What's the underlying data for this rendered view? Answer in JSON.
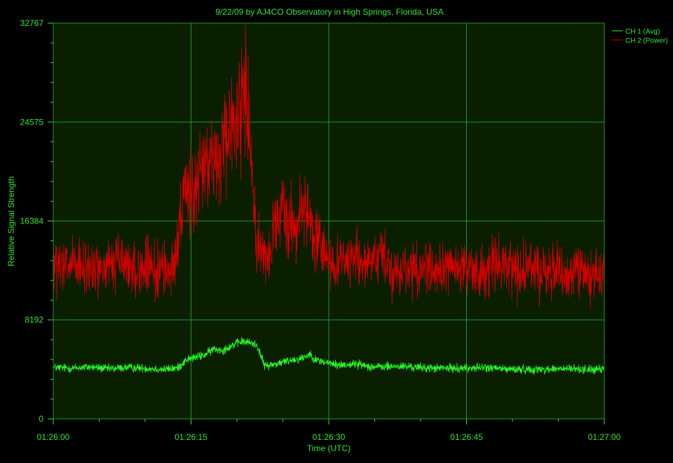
{
  "colors": {
    "background": "#000000",
    "plot_background": "#0a1f00",
    "grid": "#1f9a1f",
    "text": "#33e633",
    "ch1": "#2aff2a",
    "ch2": "#d40000"
  },
  "chart_data": {
    "type": "line",
    "title": "9/22/09  by  AJ4CO Observatory  in  High Springs, Florida, USA",
    "xlabel": "Time (UTC)",
    "ylabel": "Relative Signal Strength",
    "x_tick_labels": [
      "01:26:00",
      "01:26:15",
      "01:26:30",
      "01:26:45",
      "01:27:00"
    ],
    "x_ticks_seconds_label": "seconds after 01:26:00",
    "xlim": [
      0,
      60
    ],
    "ylim": [
      0,
      32767
    ],
    "y_ticks": [
      0,
      8192,
      16384,
      24575,
      32767
    ],
    "y_tick_labels": [
      "0",
      "8192",
      "16384",
      "24575",
      "32767"
    ],
    "grid": true,
    "legend_position": "top-right",
    "series": [
      {
        "name": "CH 1 (Avg)",
        "x": [
          0,
          2,
          4,
          6,
          8,
          10,
          12,
          13.5,
          14.5,
          15.5,
          16.5,
          17.5,
          18.5,
          19.5,
          20.5,
          21.5,
          22.2,
          23,
          24,
          25,
          26,
          27,
          28,
          28.5,
          29.5,
          31,
          33,
          35,
          38,
          41,
          44,
          47,
          50,
          53,
          56,
          58,
          60
        ],
        "y": [
          4250,
          4200,
          4300,
          4150,
          4250,
          4200,
          4100,
          4200,
          4900,
          5100,
          5300,
          5800,
          5700,
          6100,
          6400,
          6300,
          6100,
          4400,
          4500,
          4700,
          4900,
          5000,
          5400,
          4900,
          4700,
          4450,
          4550,
          4300,
          4350,
          4200,
          4200,
          4250,
          4100,
          4100,
          4150,
          4100,
          4050
        ]
      },
      {
        "name": "CH 2 (Power)",
        "x": [
          0,
          1,
          2,
          3,
          4,
          5,
          6,
          7,
          8,
          9,
          10,
          11,
          12,
          13,
          13.5,
          14,
          14.5,
          15,
          15.5,
          16,
          16.5,
          17,
          17.5,
          18,
          18.5,
          19,
          19.5,
          20,
          20.5,
          21,
          21.5,
          22,
          22.5,
          23,
          23.5,
          24,
          24.5,
          25,
          25.5,
          26,
          26.5,
          27,
          27.5,
          28,
          28.5,
          29,
          29.5,
          30,
          31,
          32,
          33,
          34,
          35,
          36,
          37,
          38,
          39,
          40,
          41,
          42,
          43,
          44,
          45,
          46,
          47,
          48,
          49,
          50,
          51,
          52,
          53,
          54,
          55,
          56,
          57,
          58,
          59,
          60
        ],
        "y": [
          12500,
          12300,
          12800,
          12200,
          12600,
          12400,
          12500,
          13200,
          12700,
          12300,
          12500,
          12200,
          12400,
          12300,
          15000,
          17000,
          18500,
          19500,
          18200,
          20500,
          21500,
          22500,
          20500,
          21500,
          22000,
          22800,
          24500,
          25500,
          26500,
          27500,
          22500,
          15500,
          14500,
          13200,
          13500,
          15500,
          16200,
          16800,
          16500,
          17200,
          15200,
          17500,
          18500,
          15500,
          14800,
          14500,
          13600,
          13300,
          12900,
          13200,
          13400,
          12800,
          12700,
          13400,
          12500,
          12500,
          12300,
          12700,
          12500,
          12300,
          12800,
          12300,
          12400,
          12200,
          12300,
          12700,
          12600,
          12300,
          12200,
          12600,
          12100,
          12500,
          12100,
          12000,
          12400,
          11900,
          12200,
          11800
        ]
      }
    ]
  }
}
